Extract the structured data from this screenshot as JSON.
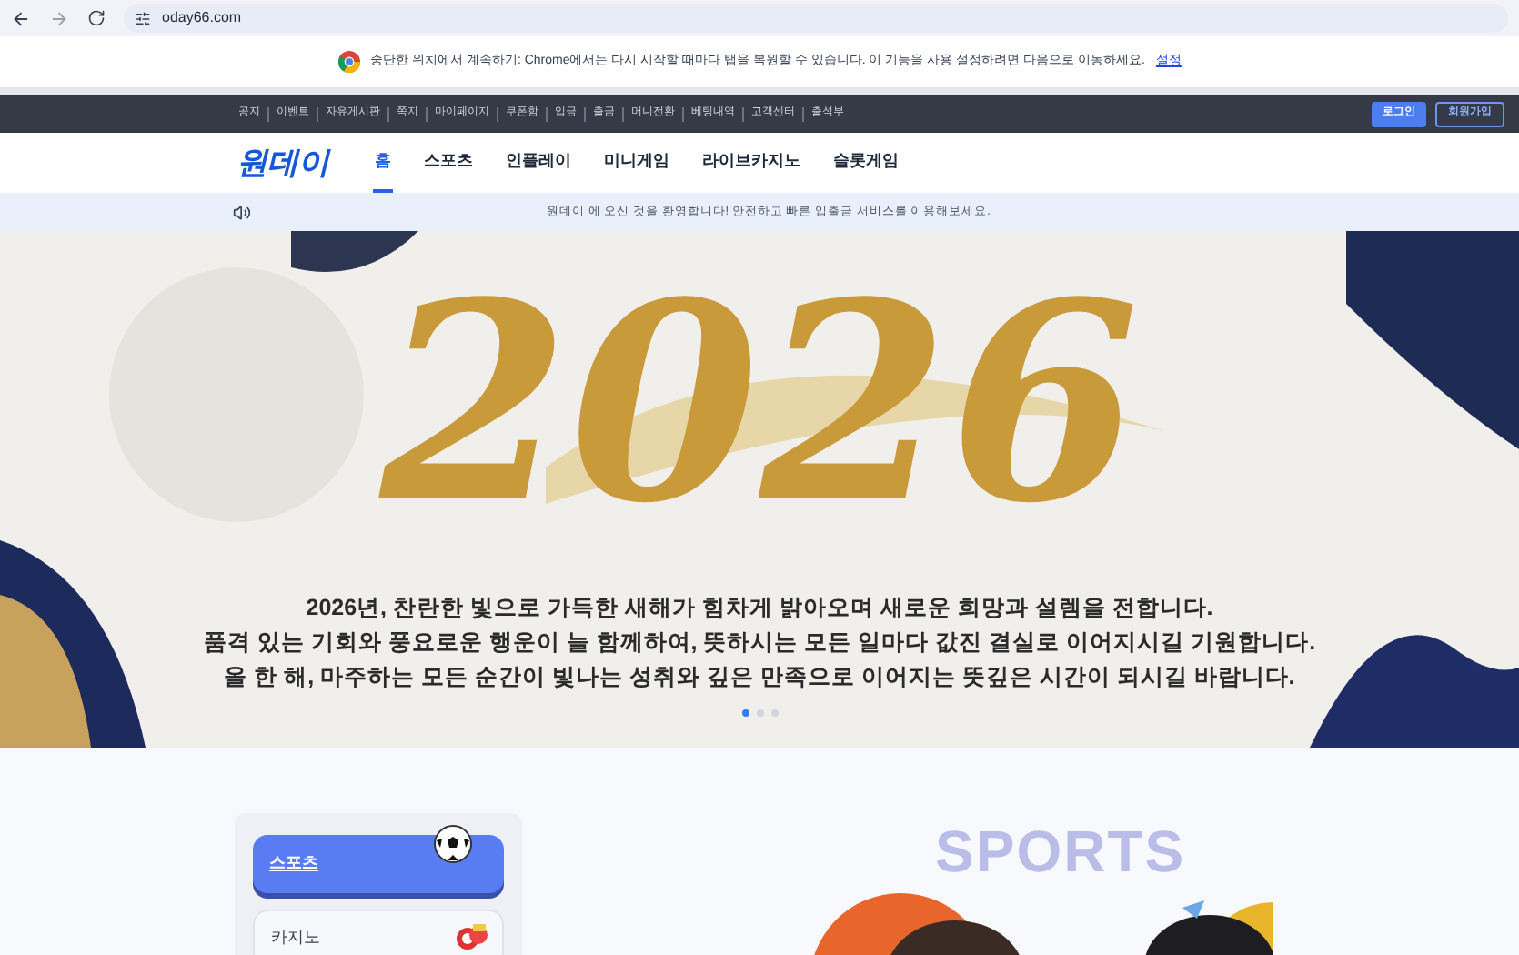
{
  "browser": {
    "url": "oday66.com"
  },
  "infobar": {
    "message": "중단한 위치에서 계속하기: Chrome에서는 다시 시작할 때마다 탭을 복원할 수 있습니다. 이 기능을 사용 설정하려면 다음으로 이동하세요.",
    "link": "설정"
  },
  "top_links": [
    "공지",
    "이벤트",
    "자유게시판",
    "쪽지",
    "마이페이지",
    "쿠폰함",
    "입금",
    "출금",
    "머니전환",
    "베팅내역",
    "고객센터",
    "출석부"
  ],
  "auth_buttons": [
    {
      "label": "로그인",
      "kind": "filled"
    },
    {
      "label": "회원가입",
      "kind": "outline"
    }
  ],
  "logo": "원데이",
  "main_tabs": [
    {
      "label": "홈",
      "selected": true
    },
    {
      "label": "스포츠",
      "selected": false
    },
    {
      "label": "인플레이",
      "selected": false
    },
    {
      "label": "미니게임",
      "selected": false
    },
    {
      "label": "라이브카지노",
      "selected": false
    },
    {
      "label": "슬롯게임",
      "selected": false
    }
  ],
  "notice": "원데이 에 오신 것을 환영합니다! 안전하고 빠른 입출금 서비스를 이용해보세요.",
  "banner": {
    "headline": "2026",
    "lines": [
      "2026년, 찬란한 빛으로 가득한 새해가 힘차게 밝아오며 새로운 희망과 설렘을 전합니다.",
      "품격 있는 기회와 풍요로운 행운이 늘 함께하여, 뜻하시는 모든 일마다 값진 결실로 이어지시길 기원합니다.",
      "올 한 해, 마주하는 모든 순간이 빛나는 성취와 깊은 만족으로 이어지는 뜻깊은 시간이 되시길 바랍니다."
    ],
    "dots": [
      {
        "selected": true
      },
      {
        "selected": false
      },
      {
        "selected": false
      }
    ]
  },
  "categories": [
    {
      "label": "스포츠",
      "selected": true
    },
    {
      "label": "카지노",
      "selected": false
    }
  ],
  "section_title": "SPORTS"
}
